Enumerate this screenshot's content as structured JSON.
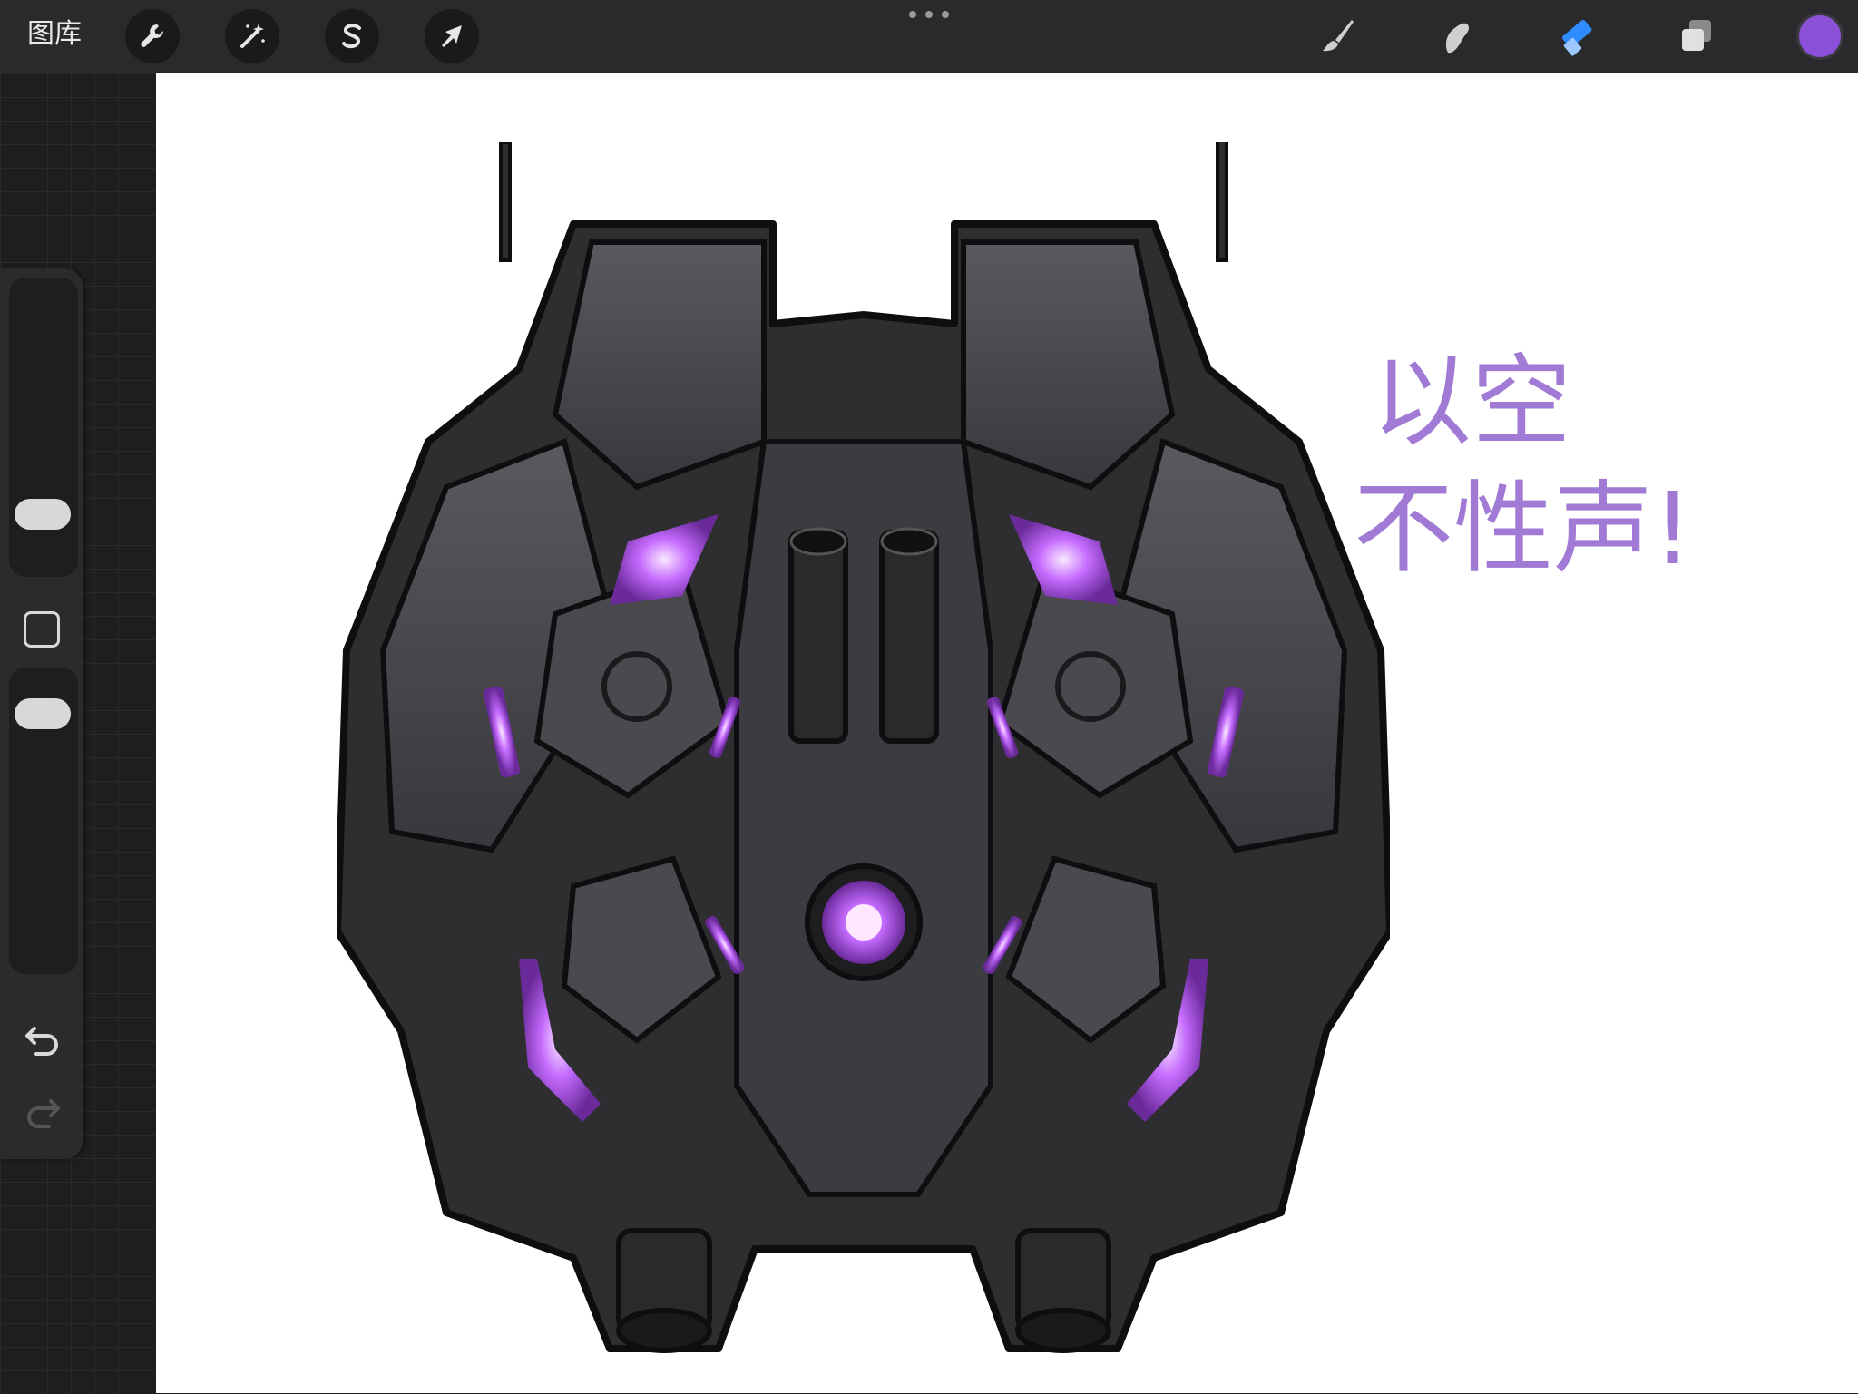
{
  "toolbar": {
    "gallery_label": "图库",
    "left_tools": [
      {
        "name": "actions",
        "icon": "wrench-icon"
      },
      {
        "name": "adjustments",
        "icon": "magic-wand-icon"
      },
      {
        "name": "selection",
        "icon": "selection-s-icon"
      },
      {
        "name": "transform",
        "icon": "arrow-cursor-icon"
      }
    ],
    "right_tools": [
      {
        "name": "brush",
        "icon": "brush-icon",
        "active": false
      },
      {
        "name": "smudge",
        "icon": "smudge-icon",
        "active": false
      },
      {
        "name": "eraser",
        "icon": "eraser-icon",
        "active": true
      },
      {
        "name": "layers",
        "icon": "layers-icon",
        "active": false
      }
    ],
    "current_color": "#8b4fd8",
    "active_tool_color": "#2f8cff"
  },
  "sidebar": {
    "controls": [
      "brush-size-slider",
      "modify-button",
      "opacity-slider",
      "undo",
      "redo"
    ]
  },
  "canvas": {
    "handwritten_note": "以空 不性声!",
    "note_color": "#a07ad4",
    "accent_glow": "#b25cff"
  }
}
